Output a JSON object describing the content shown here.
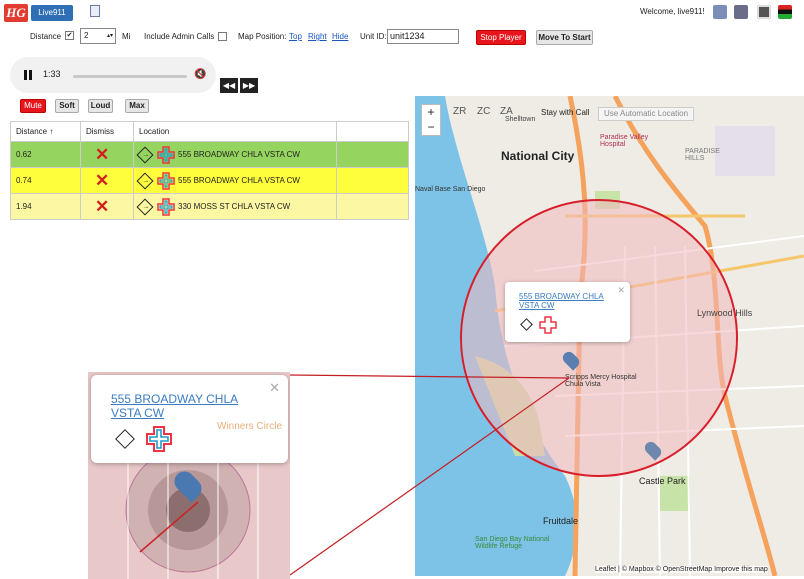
{
  "header": {
    "logo": "HG",
    "tab": "Live911",
    "welcome": "Welcome, live911!"
  },
  "controls": {
    "distance_label": "Distance",
    "distance_value": "2",
    "distance_unit": "Mi",
    "admin_label": "Include Admin Calls",
    "map_position_label": "Map Position:",
    "top": "Top",
    "right": "Right",
    "hide": "Hide",
    "unit_label": "Unit ID:",
    "unit_value": "unit1234",
    "stop_player": "Stop Player",
    "move_to_start": "Move To Start"
  },
  "player": {
    "time": "1:33",
    "progress": 0
  },
  "volume": {
    "mute": "Mute",
    "soft": "Soft",
    "loud": "Loud",
    "max": "Max"
  },
  "table": {
    "headers": [
      "Distance",
      "Dismiss",
      "Location"
    ],
    "rows": [
      {
        "distance": "0.62",
        "location": "555 BROADWAY CHLA VSTA CW",
        "color": "#95d45e"
      },
      {
        "distance": "0.74",
        "location": "555 BROADWAY CHLA VSTA CW",
        "color": "#fefe3c"
      },
      {
        "distance": "1.94",
        "location": "330 MOSS ST CHLA VSTA CW",
        "color": "#fbf7a3"
      }
    ]
  },
  "map": {
    "zoom_in": "+",
    "zoom_out": "−",
    "zr": "ZR",
    "zc": "ZC",
    "za": "ZA",
    "stay_with_call": "Stay with Call",
    "use_auto": "Use Automatic Location",
    "popup_address": "555 BROADWAY CHLA VSTA CW",
    "labels": {
      "national_city": "National City",
      "chula_vista": "Chula Vista",
      "lynwood_hills": "Lynwood Hills",
      "paradise_hills": "PARADISE HILLS",
      "castle_park": "Castle Park",
      "fruitdale": "Fruitdale",
      "scripps": "Scripps Mercy Hospital Chula Vista",
      "paradise_valley": "Paradise Valley Hospital",
      "naval_base": "Naval Base San Diego",
      "refuge": "San Diego Bay National Wildlife Refuge",
      "shelltown": "Shelltown"
    },
    "attribution": "Leaflet | © Mapbox © OpenStreetMap Improve this map"
  },
  "inset": {
    "address": "555 BROADWAY CHLA VSTA CW",
    "winners": "Winners Circle"
  },
  "colors": {
    "accent": "#2e6fb6",
    "red": "#e8161c",
    "circle": "#d81e2a"
  }
}
